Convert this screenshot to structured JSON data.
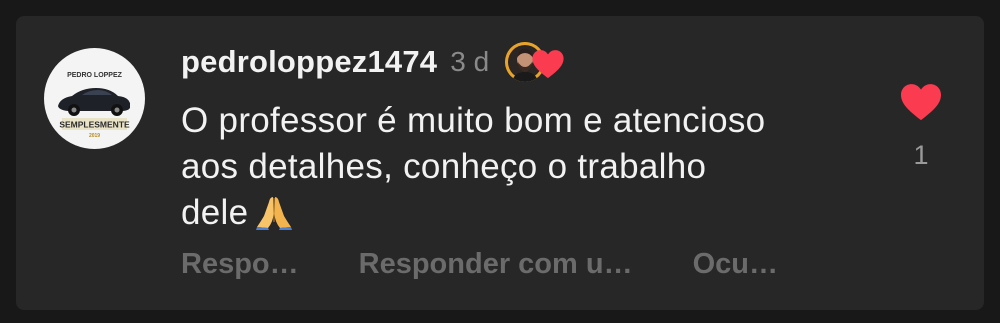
{
  "comment": {
    "avatar_text": {
      "top": "PEDRO LOPPEZ",
      "bottom": "SEMPLESMENTE",
      "sub": "2019"
    },
    "username": "pedroloppez1474",
    "time": "3 d",
    "text_line1": "O professor é muito bom e atencioso",
    "text_line2": "aos detalhes, conheço o trabalho",
    "text_line3": "dele",
    "emoji": "folded-hands",
    "like_count": "1",
    "actions": {
      "reply": "Respo…",
      "reply_with": "Responder com u…",
      "hide": "Ocu…"
    },
    "icons": {
      "like": "heart-icon",
      "creator_like": "creator-heart-icon"
    },
    "colors": {
      "heart": "#fb3b50",
      "card": "#272727",
      "background": "#181818",
      "text": "#f2f2f2",
      "muted": "#6b6b6b"
    }
  }
}
